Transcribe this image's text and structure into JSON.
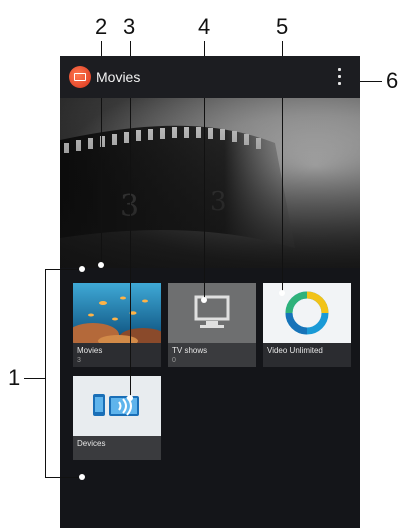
{
  "callouts": [
    "1",
    "2",
    "3",
    "4",
    "5",
    "6"
  ],
  "actionbar": {
    "title": "Movies",
    "app_icon": "movies-app-icon",
    "menu_icon": "overflow-menu-icon"
  },
  "tiles": [
    {
      "label": "Movies",
      "count": "3",
      "icon": "movies-thumbnail"
    },
    {
      "label": "TV shows",
      "count": "0",
      "icon": "tv-icon"
    },
    {
      "label": "Video Unlimited",
      "count": "",
      "icon": "video-unlimited-logo"
    },
    {
      "label": "Devices",
      "count": "",
      "icon": "devices-wireless-icon"
    }
  ],
  "colors": {
    "accent": "#e8452b",
    "tv_tile": "#6e6f70",
    "video_unlimited_ring": "#1a9ad6"
  }
}
